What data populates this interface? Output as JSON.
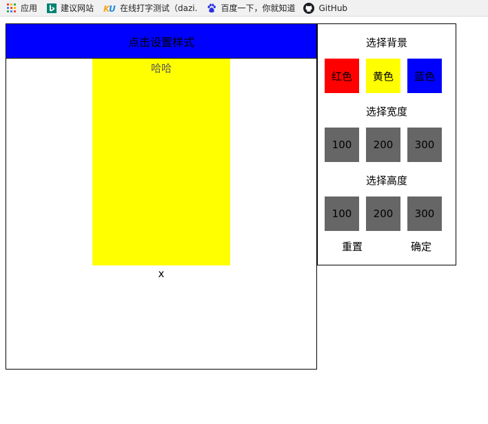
{
  "bookmarks": [
    {
      "label": "应用",
      "icon": "apps-grid-icon"
    },
    {
      "label": "建议网站",
      "icon": "bing-icon"
    },
    {
      "label": "在线打字测试（dazi.",
      "icon": "ku-icon"
    },
    {
      "label": "百度一下，你就知道",
      "icon": "baidu-paw-icon"
    },
    {
      "label": "GitHub",
      "icon": "github-icon"
    }
  ],
  "main": {
    "header_label": "点击设置样式",
    "box_text": "哈哈",
    "close_label": "x"
  },
  "panel": {
    "background_title": "选择背景",
    "backgrounds": [
      {
        "label": "红色",
        "color": "#ff0000"
      },
      {
        "label": "黄色",
        "color": "#ffff00"
      },
      {
        "label": "蓝色",
        "color": "#0000ff"
      }
    ],
    "width_title": "选择宽度",
    "widths": [
      "100",
      "200",
      "300"
    ],
    "height_title": "选择高度",
    "heights": [
      "100",
      "200",
      "300"
    ],
    "reset_label": "重置",
    "confirm_label": "确定"
  },
  "colors": {
    "header_bg": "#0000ff",
    "box_bg": "#ffff00",
    "option_gray": "#666666"
  }
}
